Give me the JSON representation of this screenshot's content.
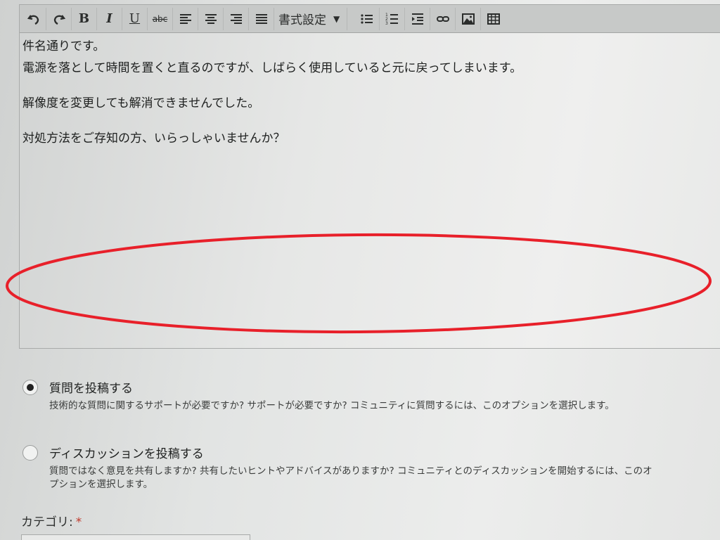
{
  "toolbar": {
    "buttons": [
      {
        "name": "undo-button",
        "glyph": "undo-icon"
      },
      {
        "name": "redo-button",
        "glyph": "redo-icon"
      },
      {
        "name": "bold-button",
        "label": "B"
      },
      {
        "name": "italic-button",
        "label": "I"
      },
      {
        "name": "underline-button",
        "label": "U"
      },
      {
        "name": "strikethrough-button",
        "label": "abc"
      },
      {
        "name": "align-left-button",
        "glyph": "align-left-icon"
      },
      {
        "name": "align-center-button",
        "glyph": "align-center-icon"
      },
      {
        "name": "align-right-button",
        "glyph": "align-right-icon"
      },
      {
        "name": "align-justify-button",
        "glyph": "align-justify-icon"
      }
    ],
    "format_label": "書式設定",
    "tools": [
      {
        "name": "bullet-list-button",
        "glyph": "bullet-list-icon"
      },
      {
        "name": "numbered-list-button",
        "glyph": "numbered-list-icon"
      },
      {
        "name": "indent-button",
        "glyph": "indent-icon"
      },
      {
        "name": "link-button",
        "glyph": "link-icon"
      },
      {
        "name": "image-button",
        "glyph": "image-icon"
      },
      {
        "name": "table-button",
        "glyph": "table-icon"
      }
    ]
  },
  "editor": {
    "line1": "件名通りです。",
    "line2": "電源を落として時間を置くと直るのですが、しばらく使用していると元に戻ってしまいます。",
    "line3": "解像度を変更しても解消できませんでした。",
    "line4": "対処方法をご存知の方、いらっしゃいませんか？",
    "annotation_color": "#e8202a"
  },
  "post_type": {
    "question": {
      "title": "質問を投稿する",
      "desc": "技術的な質問に関するサポートが必要ですか? サポートが必要ですか? コミュニティに質問するには、このオプションを選択します。",
      "selected": true
    },
    "discussion": {
      "title": "ディスカッションを投稿する",
      "desc": "質問ではなく意見を共有しますか? 共有したいヒントやアドバイスがありますか? コミュニティとのディスカッションを開始するには、このオプションを選択します。",
      "selected": false
    }
  },
  "category": {
    "label": "カテゴリ:",
    "required_mark": "*"
  }
}
